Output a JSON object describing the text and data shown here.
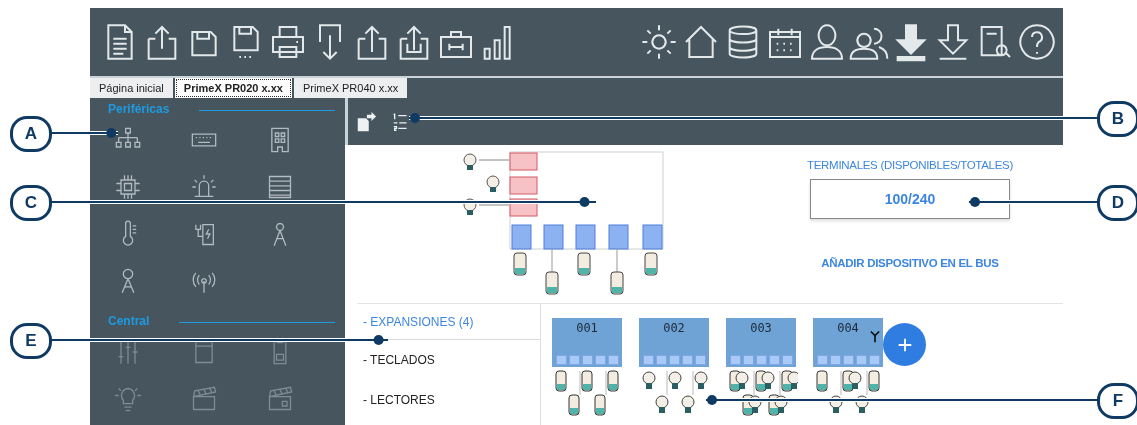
{
  "tabs": [
    {
      "label": "Página inicial",
      "selected": false
    },
    {
      "label": "PrimeX PR020 x.xx",
      "selected": true
    },
    {
      "label": "PrimeX PR040 x.xx",
      "selected": false
    }
  ],
  "sidebar": {
    "sections": [
      {
        "title": "Periféricas"
      },
      {
        "title": "Central"
      }
    ]
  },
  "bus": {
    "terminals_label": "TERMINALES (DISPONIBLES/TOTALES)",
    "terminals_value": "100/240",
    "add_device": "AÑADIR DISPOSITIVO EN EL BUS"
  },
  "device_menu": [
    {
      "label": "- EXPANSIONES (4)",
      "selected": true
    },
    {
      "label": "- TECLADOS",
      "selected": false
    },
    {
      "label": "- LECTORES",
      "selected": false
    }
  ],
  "expansions": [
    {
      "label": "001",
      "wireless": false
    },
    {
      "label": "002",
      "wireless": false
    },
    {
      "label": "003",
      "wireless": false
    },
    {
      "label": "004",
      "wireless": true
    }
  ],
  "callouts": [
    {
      "letter": "A"
    },
    {
      "letter": "C"
    },
    {
      "letter": "E"
    },
    {
      "letter": "B"
    },
    {
      "letter": "D"
    },
    {
      "letter": "F"
    }
  ]
}
